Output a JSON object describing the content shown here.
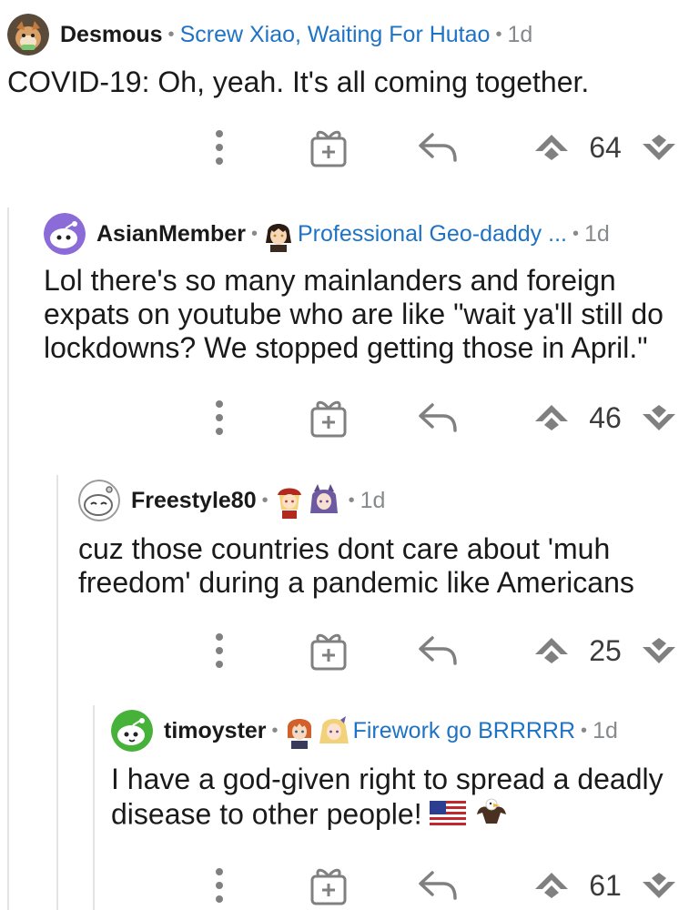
{
  "comments": [
    {
      "username": "Desmous",
      "flair": "Screw Xiao, Waiting For Hutao",
      "time": "1d",
      "body": "COVID-19: Oh, yeah. It's all coming together.",
      "score": "64"
    },
    {
      "username": "AsianMember",
      "flair": "Professional Geo-daddy ...",
      "time": "1d",
      "body": "Lol there's so many mainlanders and foreign expats on youtube who are like \"wait ya'll still do lockdowns? We stopped getting those in April.\"",
      "score": "46"
    },
    {
      "username": "Freestyle80",
      "flair": "",
      "time": "1d",
      "body": "cuz those countries dont care about 'muh freedom' during a pandemic like Americans",
      "score": "25"
    },
    {
      "username": "timoyster",
      "flair": "Firework go BRRRRR",
      "time": "1d",
      "body": "I have a god-given right to spread a deadly disease to other people!",
      "score": "61"
    }
  ],
  "separator": "•",
  "icons": {
    "more": "vertical-ellipsis-icon",
    "award": "gift-icon",
    "reply": "reply-arrow-icon",
    "upvote": "upvote-icon",
    "downvote": "downvote-icon"
  },
  "colors": {
    "flair_link": "#1f73c4",
    "meta_gray": "#878a8c",
    "thread_line": "#e3e3e3",
    "icon_gray": "#808080"
  }
}
